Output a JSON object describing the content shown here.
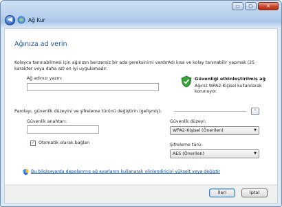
{
  "window": {
    "title": "Ağ Kur",
    "controls": {
      "minimize": "▭",
      "maximize": "▢",
      "close": "✕"
    }
  },
  "page": {
    "heading": "Ağınıza ad verin",
    "description": "Kolayca tanınabilmesi için ağınızın benzersiz bir ada gereksinimi vardırAdı kısa ve kolay tanınabilir yapmak (25 karakter veya daha az) en iyi uygulamadır."
  },
  "network_name": {
    "label": "Ağ adınızı yazın:",
    "value": ""
  },
  "security_status": {
    "title": "Güvenliği etkinleştirilmiş ağ",
    "description": "Ağınız WPA2-Kişisel kullanılarak korunuyor."
  },
  "advanced": {
    "label": "Parolayı, güvenlik düzeyini ve şifreleme türünü değiştirin (gelişmiş):",
    "collapse_symbol": "⌃",
    "security_key_label": "Güvenlik anahtarı:",
    "security_key_value": "",
    "security_level_label": "Güvenlik düzeyi:",
    "security_level_value": "WPA2-Kişisel (Önerilen)",
    "encryption_label": "Şifreleme türü:",
    "encryption_value": "AES (Önerilen)",
    "auto_connect_label": "Otomatik olarak bağlan",
    "auto_connect_checked": true
  },
  "link": {
    "text": "Bu bilgisayarda depolanmış ağ ayarlarını kullanarak yönlendiriciyi yükselt veya değiştir"
  },
  "footer": {
    "next_label": "İleri",
    "cancel_label": "İptal"
  },
  "colors": {
    "heading": "#1d4f9a",
    "link": "#0b47a8",
    "close_button": "#c9442a"
  }
}
